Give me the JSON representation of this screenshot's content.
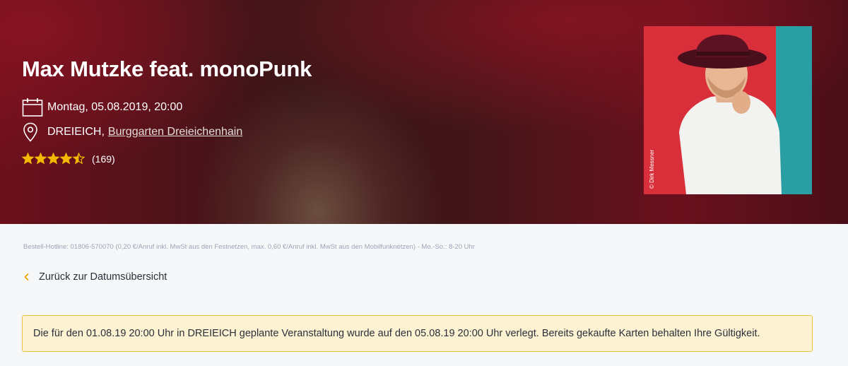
{
  "event": {
    "title": "Max Mutzke feat. monoPunk",
    "date": "Montag, 05.08.2019, 20:00",
    "city": "DREIEICH,",
    "venue": "Burggarten Dreieichenhain",
    "rating_value": 4.5,
    "rating_max": 5,
    "rating_count": "(169)",
    "photo_credit": "© Dirk Messner"
  },
  "hotline": "Bestell-Hotline: 01806-570070 (0,20 €/Anruf inkl. MwSt aus den Festnetzen, max. 0,60 €/Anruf inkl. MwSt aus den Mobilfunknetzen) - Mo.-So.: 8-20 Uhr",
  "back_link": "Zurück zur Datumsübersicht",
  "notice": "Die für den 01.08.19 20:00 Uhr in DREIEICH geplante Veranstaltung wurde auf den 05.08.19 20:00 Uhr verlegt. Bereits gekaufte Karten behalten Ihre Gültigkeit.",
  "colors": {
    "star": "#f5b800",
    "accent": "#f0a500",
    "notice_bg": "#fdf3d2",
    "notice_border": "#f0c040"
  },
  "icons": {
    "date": "calendar-icon",
    "venue": "location-pin-icon",
    "back": "chevron-left-icon"
  }
}
